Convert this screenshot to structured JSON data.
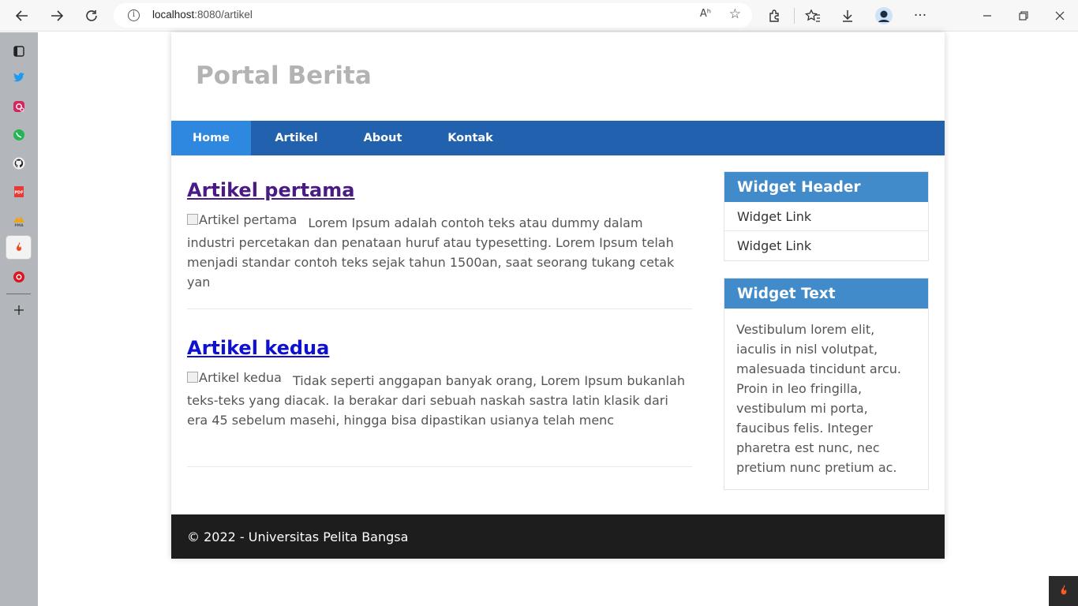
{
  "browser": {
    "url_host": "localhost",
    "url_path": ":8080/artikel",
    "read_aloud": "Aʰ",
    "icons": [
      "back-icon",
      "forward-icon",
      "refresh-icon",
      "site-info-icon",
      "add-favorite-icon",
      "extensions-icon",
      "favorites-icon",
      "downloads-icon",
      "profile-icon",
      "more-icon",
      "minimize-icon",
      "restore-icon",
      "close-icon"
    ]
  },
  "sidebar": {
    "items": [
      "tabs-icon",
      "twitter-icon",
      "instagram-icon",
      "whatsapp-icon",
      "github-icon",
      "pdf-icon",
      "pma-icon",
      "codeigniter-icon",
      "record-icon",
      "add-icon"
    ]
  },
  "site": {
    "title": "Portal Berita",
    "nav": [
      "Home",
      "Artikel",
      "About",
      "Kontak"
    ],
    "nav_active": "Home"
  },
  "articles": [
    {
      "title": "Artikel pertama",
      "img_alt": "Artikel pertama",
      "excerpt": "Lorem Ipsum adalah contoh teks atau dummy dalam industri percetakan dan penataan huruf atau typesetting. Lorem Ipsum telah menjadi standar contoh teks sejak tahun 1500an, saat seorang tukang cetak yan"
    },
    {
      "title": "Artikel kedua",
      "img_alt": "Artikel kedua",
      "excerpt": "Tidak seperti anggapan banyak orang, Lorem Ipsum bukanlah teks-teks yang diacak. Ia berakar dari sebuah naskah sastra latin klasik dari era 45 sebelum masehi, hingga bisa dipastikan usianya telah menc"
    }
  ],
  "widgets": {
    "header_title": "Widget Header",
    "links": [
      "Widget Link",
      "Widget Link"
    ],
    "text_title": "Widget Text",
    "text_body": "Vestibulum lorem elit, iaculis in nisl volutpat, malesuada tincidunt arcu. Proin in leo fringilla, vestibulum mi porta, faucibus felis. Integer pharetra est nunc, nec pretium nunc pretium ac."
  },
  "footer": {
    "text": "© 2022 - Universitas Pelita Bangsa"
  },
  "colors": {
    "nav_bg": "#2161ad",
    "nav_active": "#2f88e0",
    "widget_head": "#428bca",
    "footer_bg": "#1d1d1d",
    "title_gray": "#b3b3b3"
  }
}
